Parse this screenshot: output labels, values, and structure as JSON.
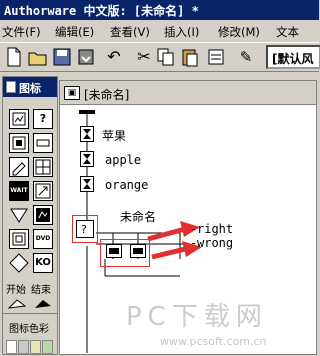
{
  "app": {
    "title": "Authorware 中文版: [未命名] *"
  },
  "menu": [
    "文件(F)",
    "编辑(E)",
    "查看(V)",
    "插入(I)",
    "修改(M)",
    "文本"
  ],
  "toolbar": {
    "font_value": "[默认风",
    "icons": [
      "new-icon",
      "open-icon",
      "save-icon",
      "import-icon",
      "undo-icon",
      "cut-icon",
      "copy-icon",
      "paste-icon",
      "find-icon",
      "bold-icon"
    ]
  },
  "palette": {
    "title": "图标",
    "icons": [
      {
        "name": "display-icon",
        "glyph": "▣"
      },
      {
        "name": "motion-icon",
        "glyph": "?"
      },
      {
        "name": "erase-icon",
        "glyph": "⊡"
      },
      {
        "name": "wait-icon",
        "glyph": "▭"
      },
      {
        "name": "navigate-icon",
        "glyph": "✎"
      },
      {
        "name": "framework-icon",
        "glyph": "▦"
      },
      {
        "name": "decision-icon",
        "glyph": "WAIT"
      },
      {
        "name": "interaction-icon",
        "glyph": "↗"
      },
      {
        "name": "calculation-icon",
        "glyph": "▽"
      },
      {
        "name": "map-icon",
        "glyph": "▤"
      },
      {
        "name": "digital-movie-icon",
        "glyph": "◇"
      },
      {
        "name": "sound-icon",
        "glyph": "DVD"
      },
      {
        "name": "video-icon",
        "glyph": "◇"
      },
      {
        "name": "knowledge-object-icon",
        "glyph": "KO"
      }
    ],
    "start_label": "开始",
    "end_label": "结束",
    "color_label": "图标色彩",
    "swatch_colors": [
      "#ffffff",
      "#c8c8c8",
      "#e8e4b0",
      "#b8d8a8"
    ]
  },
  "design_window": {
    "title": "[未命名]",
    "flow_labels": [
      "苹果",
      "apple",
      "orange",
      "未命名"
    ],
    "branch_labels": [
      "right",
      "wrong"
    ],
    "accent_color": "#e03030"
  },
  "watermark": {
    "main": "PC下载网",
    "url": "www.pcsoft.com.cn"
  }
}
